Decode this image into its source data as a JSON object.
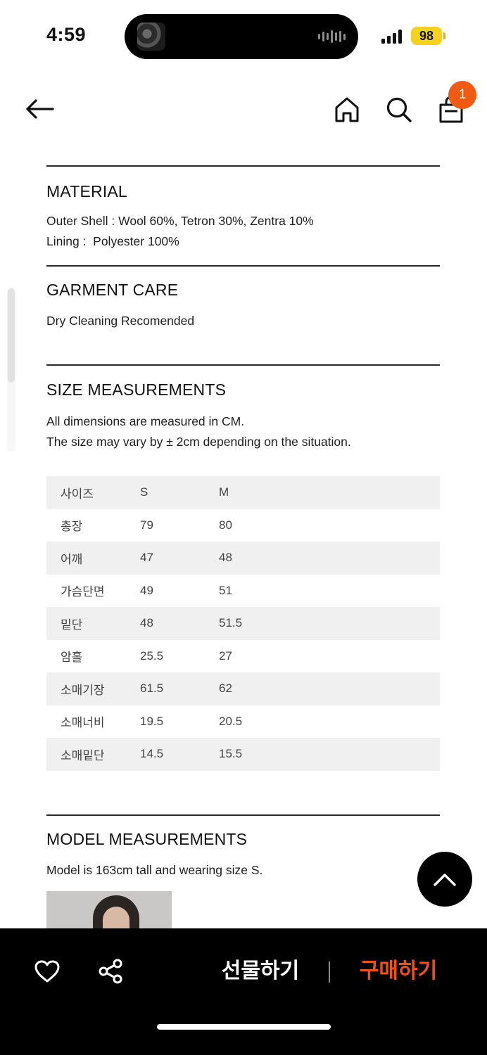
{
  "status_bar": {
    "time": "4:59",
    "battery": "98",
    "battery_color": "#f5d31c"
  },
  "nav": {
    "icons": [
      "arrow-left-icon",
      "home-icon",
      "search-icon",
      "shopping-bag-icon"
    ],
    "cart_count": "1",
    "badge_color": "#f05a12"
  },
  "material": {
    "title": "MATERIAL",
    "lines": [
      "Outer Shell : Wool 60%, Tetron 30%, Zentra 10%",
      "Lining :  Polyester 100%"
    ]
  },
  "care": {
    "title": "GARMENT CARE",
    "lines": [
      "Dry Cleaning Recomended"
    ]
  },
  "size": {
    "title": "SIZE MEASUREMENTS",
    "lines": [
      "All dimensions are measured in CM.",
      "The size may vary by ± 2cm depending on the situation."
    ],
    "table": {
      "rows": [
        [
          "사이즈",
          "S",
          "M"
        ],
        [
          "총장",
          "79",
          "80"
        ],
        [
          "어깨",
          "47",
          "48"
        ],
        [
          "가슴단면",
          "49",
          "51"
        ],
        [
          "밑단",
          "48",
          "51.5"
        ],
        [
          "암홀",
          "25.5",
          "27"
        ],
        [
          "소매기장",
          "61.5",
          "62"
        ],
        [
          "소매너비",
          "19.5",
          "20.5"
        ],
        [
          "소매밑단",
          "14.5",
          "15.5"
        ]
      ]
    }
  },
  "model": {
    "title": "MODEL MEASUREMENTS",
    "lines": [
      "Model is 163cm tall and wearing size S."
    ]
  },
  "floating": {
    "icon": "chevron-up-icon"
  },
  "bottom_bar": {
    "like_icon": "heart-icon",
    "share_icon": "share-icon",
    "gift_label": "선물하기",
    "buy_label": "구매하기",
    "buy_color": "#f0501a"
  }
}
